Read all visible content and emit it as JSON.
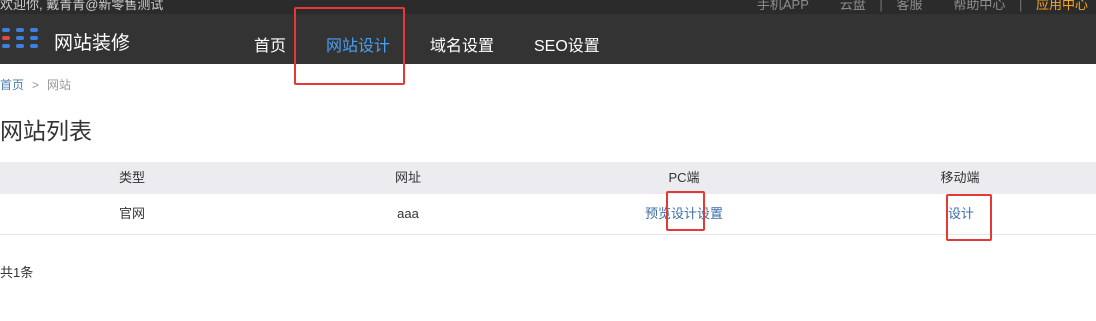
{
  "topbar": {
    "welcome": "欢迎你, 戴青青@新零售测试",
    "links": [
      "手机APP",
      "云盘",
      "客服",
      "帮助中心",
      "应用中心"
    ]
  },
  "navbar": {
    "brand": "网站装修",
    "items": [
      {
        "label": "首页",
        "active": false
      },
      {
        "label": "网站设计",
        "active": true
      },
      {
        "label": "域名设置",
        "active": false
      },
      {
        "label": "SEO设置",
        "active": false
      }
    ]
  },
  "breadcrumb": {
    "home": "首页",
    "separator": ">",
    "current": "网站"
  },
  "page_title": "网站列表",
  "table": {
    "headers": [
      "类型",
      "网址",
      "PC端",
      "移动端"
    ],
    "rows": [
      {
        "type": "官网",
        "url": "aaa",
        "pc_actions": [
          "预览",
          "设计",
          "设置"
        ],
        "mobile_actions": [
          "设计"
        ]
      }
    ]
  },
  "total": "共1条",
  "colors": {
    "nav_bg": "#333333",
    "active_nav": "#4a9ff5",
    "link": "#3b6ea8",
    "highlight": "#e53935",
    "apps_link": "#f5a623"
  },
  "icons": {
    "logo": "app-grid-icon"
  }
}
